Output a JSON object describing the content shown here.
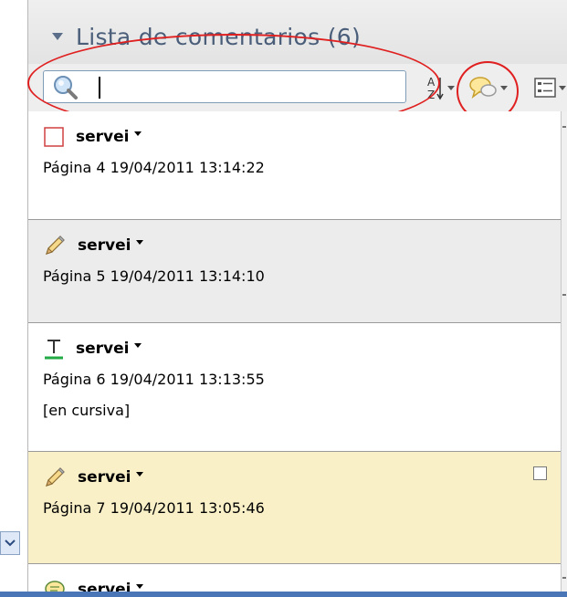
{
  "panel": {
    "title": "Lista de comentarios (6)"
  },
  "search": {
    "value": "",
    "placeholder": ""
  },
  "colors": {
    "selected_item_bg": "#faf0c8",
    "alt_item_bg": "#ececec",
    "annotation_red": "#e02020",
    "accent_blue": "#4a76b8"
  },
  "comments": [
    {
      "icon": "rectangle-icon",
      "author": "servei",
      "meta": "Página 4  19/04/2011 13:14:22",
      "note": ""
    },
    {
      "icon": "pencil-icon",
      "author": "servei",
      "meta": "Página 5  19/04/2011 13:14:10",
      "note": ""
    },
    {
      "icon": "text-insert-icon",
      "author": "servei",
      "meta": "Página 6  19/04/2011 13:13:55",
      "note": "[en cursiva]"
    },
    {
      "icon": "pencil-icon",
      "author": "servei",
      "meta": "Página 7  19/04/2011 13:05:46",
      "note": ""
    },
    {
      "icon": "speech-bubble-icon",
      "author": "servei",
      "meta": "",
      "note": ""
    }
  ]
}
